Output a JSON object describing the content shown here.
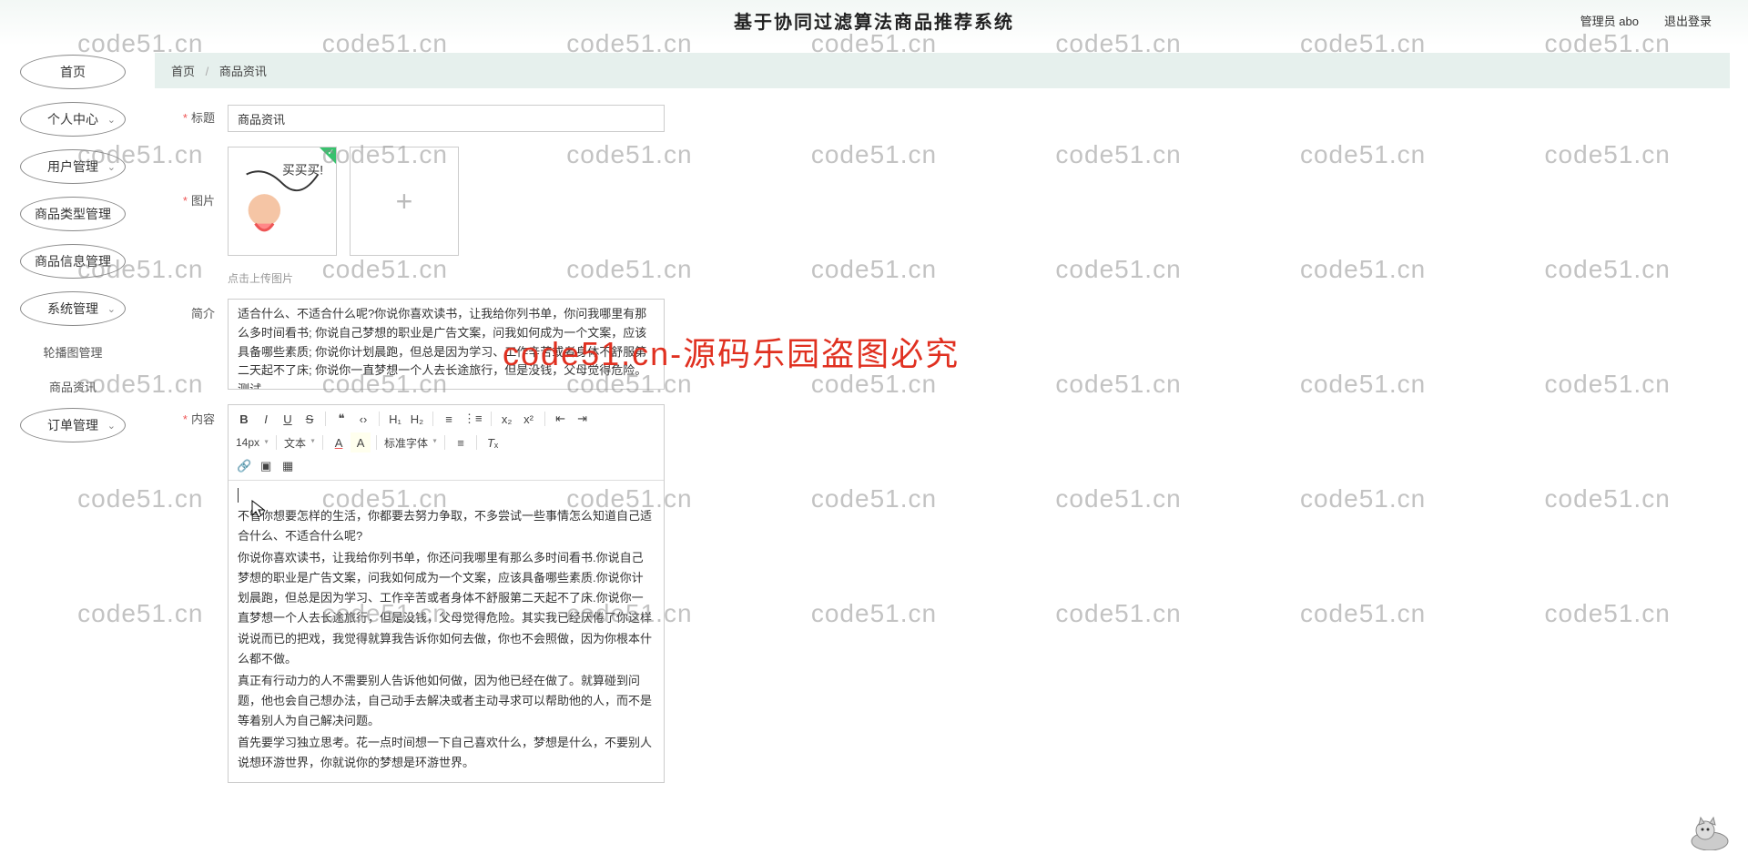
{
  "header": {
    "title": "基于协同过滤算法商品推荐系统",
    "admin_label": "管理员 abo",
    "logout_label": "退出登录"
  },
  "sidebar": {
    "items": [
      {
        "label": "首页",
        "expand": false
      },
      {
        "label": "个人中心",
        "expand": true
      },
      {
        "label": "用户管理",
        "expand": true
      },
      {
        "label": "商品类型管理",
        "expand": false
      },
      {
        "label": "商品信息管理",
        "expand": false
      },
      {
        "label": "系统管理",
        "expand": true
      }
    ],
    "sub_items": [
      {
        "label": "轮播图管理"
      },
      {
        "label": "商品资讯"
      }
    ],
    "last_item": {
      "label": "订单管理",
      "expand": true
    }
  },
  "breadcrumb": {
    "home": "首页",
    "current": "商品资讯"
  },
  "form": {
    "title_label": "标题",
    "title_value": "商品资讯",
    "image_label": "图片",
    "upload_hint": "点击上传图片",
    "intro_label": "简介",
    "intro_value": "适合什么、不适合什么呢?你说你喜欢读书，让我给你列书单，你问我哪里有那么多时间看书; 你说自己梦想的职业是广告文案，问我如何成为一个文案，应该具备哪些素质; 你说你计划晨跑，但总是因为学习、工作辛苦或者身体不舒服第二天起不了床; 你说你一直梦想一个人去长途旅行，但是没钱，父母觉得危险。测试",
    "content_label": "内容",
    "editor_content": [
      "不管你想要怎样的生活，你都要去努力争取，不多尝试一些事情怎么知道自己适合什么、不适合什么呢?",
      "你说你喜欢读书，让我给你列书单，你还问我哪里有那么多时间看书.你说自己梦想的职业是广告文案，问我如何成为一个文案，应该具备哪些素质.你说你计划晨跑，但总是因为学习、工作辛苦或者身体不舒服第二天起不了床.你说你一直梦想一个人去长途旅行，但是没钱，父母觉得危险。其实我已经厌倦了你这样说说而已的把戏，我觉得就算我告诉你如何去做，你也不会照做，因为你根本什么都不做。",
      "真正有行动力的人不需要别人告诉他如何做，因为他已经在做了。就算碰到问题，他也会自己想办法，自己动手去解决或者主动寻求可以帮助他的人，而不是等着别人为自己解决问题。",
      "首先要学习独立思考。花一点时间想一下自己喜欢什么，梦想是什么，不要别人说想环游世界，你就说你的梦想是环游世界。"
    ]
  },
  "editor_toolbar": {
    "font_size": "14px",
    "text_type": "文本",
    "font_family": "标准字体"
  },
  "watermark": "code51.cn",
  "red_text": "code51.cn-源码乐园盗图必究"
}
